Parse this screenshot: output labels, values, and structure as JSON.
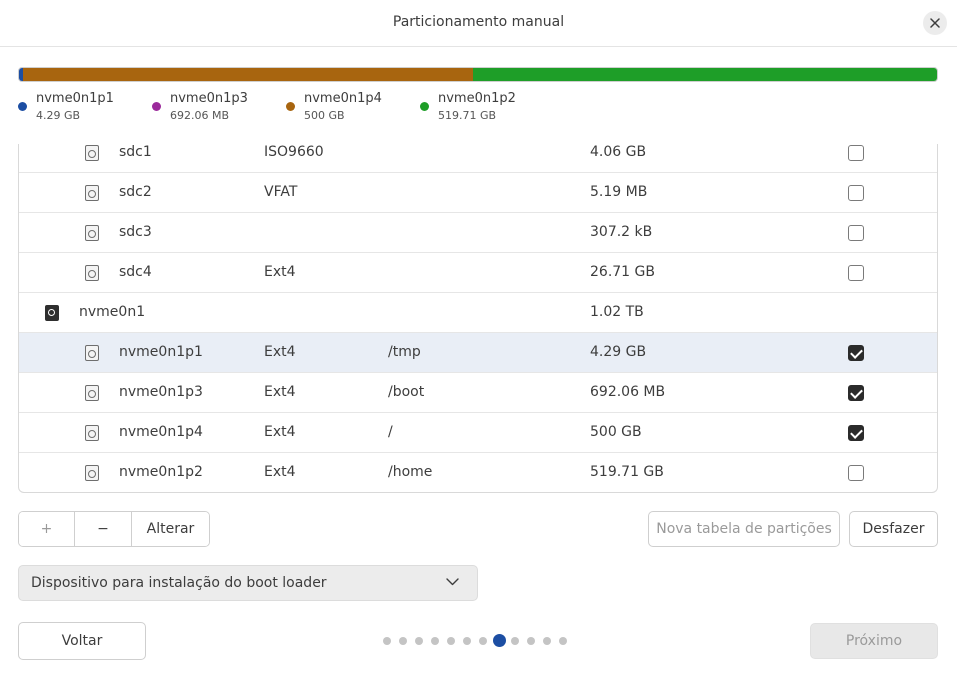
{
  "window": {
    "title": "Particionamento manual"
  },
  "disk_bar": {
    "segments": [
      {
        "name": "nvme0n1p1",
        "color": "#1c4ea3",
        "fraction": 0.0042
      },
      {
        "name": "nvme0n1p3",
        "color": "#9b2a9b",
        "fraction": 0.0007
      },
      {
        "name": "nvme0n1p4",
        "color": "#a8650f",
        "fraction": 0.4895
      },
      {
        "name": "nvme0n1p2",
        "color": "#1e9e28",
        "fraction": 0.5056
      }
    ]
  },
  "legend": [
    {
      "name": "nvme0n1p1",
      "size": "4.29 GB",
      "color": "#1c4ea3"
    },
    {
      "name": "nvme0n1p3",
      "size": "692.06 MB",
      "color": "#9b2a9b"
    },
    {
      "name": "nvme0n1p4",
      "size": "500 GB",
      "color": "#a8650f"
    },
    {
      "name": "nvme0n1p2",
      "size": "519.71 GB",
      "color": "#1e9e28"
    }
  ],
  "rows": [
    {
      "kind": "partition",
      "name": "sdc1",
      "fs": "ISO9660",
      "mount": "",
      "size": "4.06 GB",
      "format": false
    },
    {
      "kind": "partition",
      "name": "sdc2",
      "fs": "VFAT",
      "mount": "",
      "size": "5.19 MB",
      "format": false
    },
    {
      "kind": "partition",
      "name": "sdc3",
      "fs": "",
      "mount": "",
      "size": "307.2 kB",
      "format": false
    },
    {
      "kind": "partition",
      "name": "sdc4",
      "fs": "Ext4",
      "mount": "",
      "size": "26.71 GB",
      "format": false
    },
    {
      "kind": "disk",
      "name": "nvme0n1",
      "fs": "",
      "mount": "",
      "size": "1.02 TB"
    },
    {
      "kind": "partition",
      "name": "nvme0n1p1",
      "fs": "Ext4",
      "mount": "/tmp",
      "size": "4.29 GB",
      "format": true,
      "selected": true
    },
    {
      "kind": "partition",
      "name": "nvme0n1p3",
      "fs": "Ext4",
      "mount": "/boot",
      "size": "692.06 MB",
      "format": true
    },
    {
      "kind": "partition",
      "name": "nvme0n1p4",
      "fs": "Ext4",
      "mount": "/",
      "size": "500 GB",
      "format": true
    },
    {
      "kind": "partition",
      "name": "nvme0n1p2",
      "fs": "Ext4",
      "mount": "/home",
      "size": "519.71 GB",
      "format": false
    }
  ],
  "toolbar": {
    "add_label": "+",
    "remove_label": "−",
    "change_label": "Alterar",
    "new_table_label": "Nova tabela de partições",
    "undo_label": "Desfazer"
  },
  "bootloader": {
    "label": "Dispositivo para instalação do boot loader"
  },
  "nav": {
    "back_label": "Voltar",
    "next_label": "Próximo",
    "steps_total": 12,
    "current_step": 8
  }
}
